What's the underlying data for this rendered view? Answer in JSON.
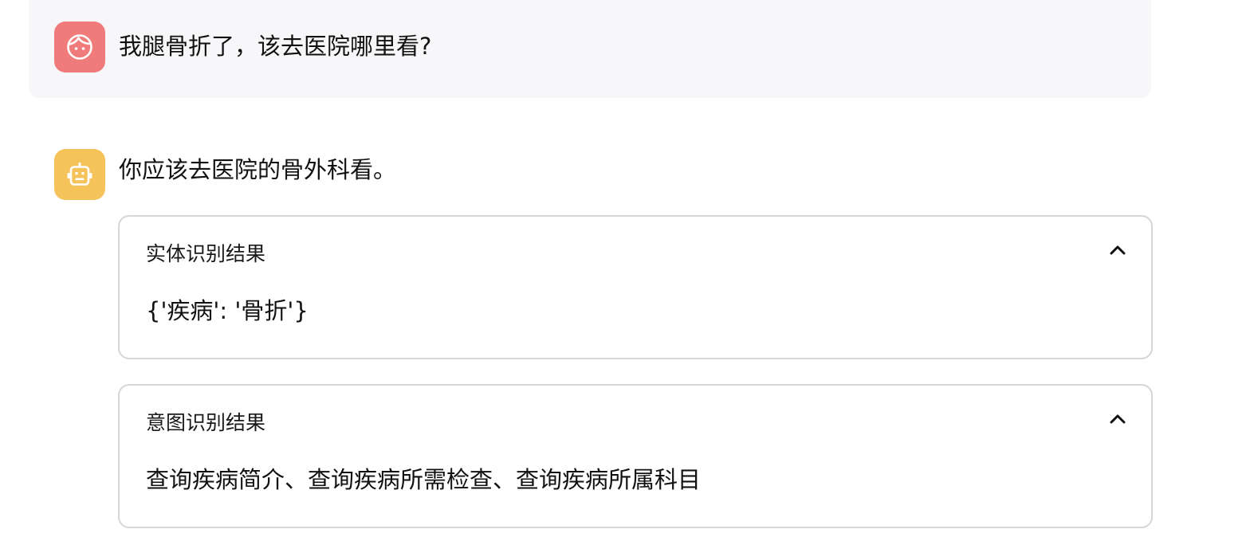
{
  "conversation": {
    "user_message": {
      "avatar_icon": "girl-face-icon",
      "avatar_color": "#ef7b7b",
      "text": "我腿骨折了，该去医院哪里看?"
    },
    "bot_message": {
      "avatar_icon": "robot-icon",
      "avatar_color": "#f6c35b",
      "text": "你应该去医院的骨外科看。"
    },
    "panels": [
      {
        "title": "实体识别结果",
        "toggle_icon": "chevron-up-icon",
        "content": "{'疾病': '骨折'}"
      },
      {
        "title": "意图识别结果",
        "toggle_icon": "chevron-up-icon",
        "content": "查询疾病简介、查询疾病所需检查、查询疾病所属科目"
      }
    ]
  }
}
